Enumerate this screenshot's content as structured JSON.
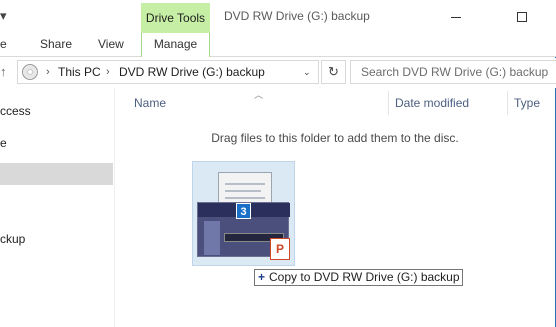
{
  "window": {
    "title": "DVD RW Drive (G:) backup",
    "qa_glyph": "ˢ"
  },
  "ribbon": {
    "contextual_tab": "Drive Tools",
    "tabs": [
      {
        "label": "e"
      },
      {
        "label": "Share"
      },
      {
        "label": "View"
      },
      {
        "label": "Manage"
      }
    ]
  },
  "address": {
    "crumbs": [
      "This PC",
      "DVD RW Drive (G:) backup"
    ],
    "search_placeholder": "Search DVD RW Drive (G:) backup"
  },
  "nav": {
    "items": [
      {
        "label": "ccess"
      },
      {
        "label": "e"
      },
      {
        "label": ""
      },
      {
        "label": "ckup"
      }
    ]
  },
  "columns": {
    "name": "Name",
    "date_modified": "Date modified",
    "type": "Type"
  },
  "content": {
    "hint": "Drag files to this folder to add them to the disc."
  },
  "drag": {
    "badge": "3",
    "ppt_letter": "P",
    "tooltip": "Copy to DVD RW Drive (G:) backup"
  },
  "colors": {
    "contextual_tab_bg": "#c6efa5",
    "selection": "#d9d9d9",
    "badge": "#1a6fc9",
    "header_text": "#4d6082"
  }
}
